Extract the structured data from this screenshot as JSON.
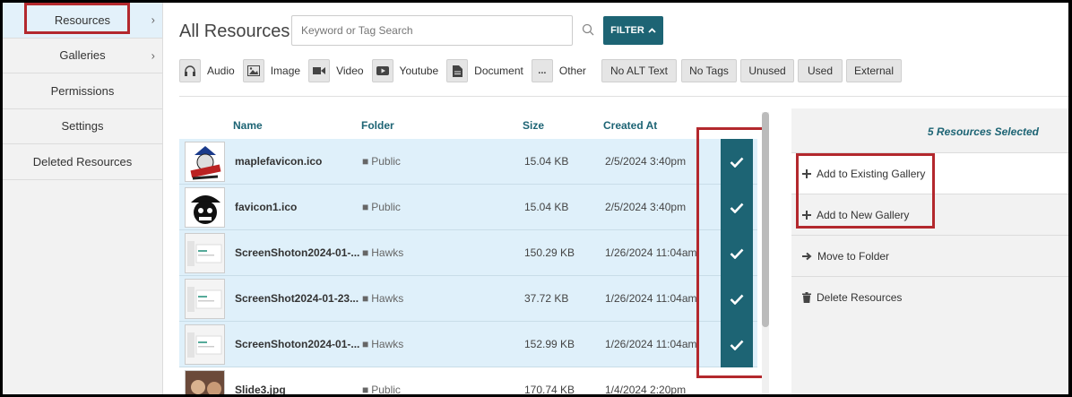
{
  "sidebar": {
    "items": [
      {
        "label": "Resources",
        "chevron": "›"
      },
      {
        "label": "Galleries",
        "chevron": "›"
      },
      {
        "label": "Permissions"
      },
      {
        "label": "Settings"
      },
      {
        "label": "Deleted Resources"
      }
    ]
  },
  "header": {
    "title": "All Resources",
    "search_placeholder": "Keyword or Tag Search",
    "filter_label": "FILTER"
  },
  "type_filters": [
    "Audio",
    "Image",
    "Video",
    "Youtube",
    "Document",
    "Other"
  ],
  "other_icon_text": "...",
  "tag_filters": [
    "No ALT Text",
    "No Tags",
    "Unused",
    "Used",
    "External"
  ],
  "table": {
    "columns": [
      "Name",
      "Folder",
      "Size",
      "Created At"
    ],
    "rows": [
      {
        "name": "maplefavicon.ico",
        "folder": "Public",
        "size": "15.04 KB",
        "created": "2/5/2024 3:40pm",
        "selected": true
      },
      {
        "name": "favicon1.ico",
        "folder": "Public",
        "size": "15.04 KB",
        "created": "2/5/2024 3:40pm",
        "selected": true
      },
      {
        "name": "ScreenShoton2024-01-...",
        "folder": "Hawks",
        "size": "150.29 KB",
        "created": "1/26/2024 11:04am",
        "selected": true
      },
      {
        "name": "ScreenShot2024-01-23...",
        "folder": "Hawks",
        "size": "37.72 KB",
        "created": "1/26/2024 11:04am",
        "selected": true
      },
      {
        "name": "ScreenShoton2024-01-...",
        "folder": "Hawks",
        "size": "152.99 KB",
        "created": "1/26/2024 11:04am",
        "selected": true
      },
      {
        "name": "Slide3.jpg",
        "folder": "Public",
        "size": "170.74 KB",
        "created": "1/4/2024 2:20pm",
        "selected": false
      }
    ]
  },
  "panel": {
    "selected_text": "5 Resources Selected",
    "actions": [
      {
        "label": "Add to Existing Gallery",
        "icon": "plus-icon"
      },
      {
        "label": "Add to New Gallery",
        "icon": "plus-icon"
      },
      {
        "label": "Move to Folder",
        "icon": "arrow-right-icon"
      },
      {
        "label": "Delete Resources",
        "icon": "trash-icon"
      }
    ]
  },
  "colors": {
    "accent": "#1d6474",
    "highlight": "#b3282d",
    "selected_row": "#dff0fa"
  }
}
